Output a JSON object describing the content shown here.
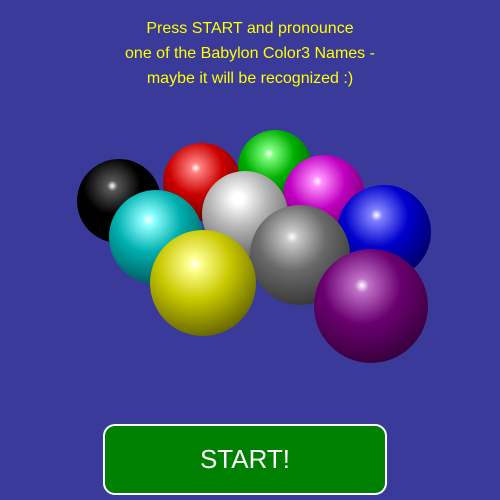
{
  "instructions": {
    "line1": "Press START and pronounce",
    "line2": "one of the Babylon Color3 Names -",
    "line3": "maybe it will be recognized :)"
  },
  "spheres": [
    {
      "name": "black",
      "color": "#000000",
      "highlight": "#555555",
      "shadow": "#000000"
    },
    {
      "name": "red",
      "color": "#cc0000",
      "highlight": "#ff8080",
      "shadow": "#300000"
    },
    {
      "name": "green",
      "color": "#00b000",
      "highlight": "#80ff80",
      "shadow": "#002a00"
    },
    {
      "name": "magenta",
      "color": "#c000c0",
      "highlight": "#ff90ff",
      "shadow": "#300030"
    },
    {
      "name": "white",
      "color": "#b5b5b5",
      "highlight": "#ffffff",
      "shadow": "#3c3c3c"
    },
    {
      "name": "cyan",
      "color": "#00b0b0",
      "highlight": "#90ffff",
      "shadow": "#002e2e"
    },
    {
      "name": "blue",
      "color": "#0000cc",
      "highlight": "#8080ff",
      "shadow": "#00002e"
    },
    {
      "name": "gray",
      "color": "#6a6a6a",
      "highlight": "#c8c8c8",
      "shadow": "#1c1c1c"
    },
    {
      "name": "yellow",
      "color": "#c8c800",
      "highlight": "#ffff90",
      "shadow": "#303000"
    },
    {
      "name": "purple",
      "color": "#6a0070",
      "highlight": "#c070c8",
      "shadow": "#1c001e"
    }
  ],
  "start_button": {
    "label": "START!",
    "background": "#008000"
  },
  "colors": {
    "background": "#3a3a9a",
    "text": "#ffff00"
  }
}
